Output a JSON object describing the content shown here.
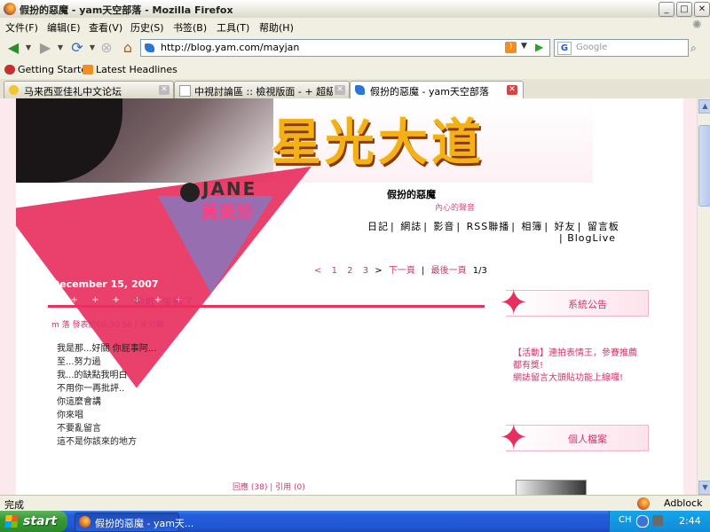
{
  "window": {
    "title": "假扮的惡魔 - yam天空部落 - Mozilla Firefox",
    "controls": {
      "minimize": "_",
      "maximize": "□",
      "close": "✕"
    }
  },
  "menu": [
    "文件(F)",
    "编辑(E)",
    "查看(V)",
    "历史(S)",
    "书签(B)",
    "工具(T)",
    "帮助(H)"
  ],
  "nav": {
    "url": "http://blog.yam.com/mayjan",
    "search_placeholder": "Google"
  },
  "bookmarks": [
    "Getting Started",
    "Latest Headlines"
  ],
  "tabs": [
    {
      "label": "马来西亚佳礼中文论坛",
      "active": false
    },
    {
      "label": "中視討論區 :: 檢視版面 - + 超級星...",
      "active": false
    },
    {
      "label": "假扮的惡魔 - yam天空部落",
      "active": true
    }
  ],
  "banner": {
    "logo": "星光大道",
    "jane": "JANE",
    "jane_cn": "黃美珍"
  },
  "blog": {
    "title": "假扮的惡魔",
    "subtitle": "內心的聲音",
    "nav": [
      "日記",
      "網誌",
      "影音",
      "RSS聯播",
      "相簿",
      "好友",
      "留言板"
    ],
    "nav_row2": "BlogLive",
    "pager": {
      "prev": "<",
      "pages": [
        "1",
        "2",
        "3"
      ],
      "next": ">",
      "next_page": "下一頁",
      "last_page": "最後一頁",
      "position": "1/3"
    }
  },
  "post": {
    "date": "December 15, 2007",
    "title": "抱歉..失態了",
    "meta": "m  落  發表於00:30:58 | 未分類",
    "lines": [
      "我是那...好關 你屁事阿...",
      "至...努力過",
      "我...的缺點我明白",
      "不用你一再批評..",
      "你這麼會講",
      "你來唱",
      "不要亂留言",
      "這不是你該來的地方"
    ],
    "footer": "回應 (38) | 引用 (0)"
  },
  "sidebar": {
    "announce_title": "系統公告",
    "announce_links": [
      "【活動】連拍表情王，參賽推薦",
      "都有獎!",
      "網誌留言大頭貼功能上線囉!"
    ],
    "profile_title": "個人檔案"
  },
  "status": {
    "text": "完成",
    "addon": "Adblock"
  },
  "taskbar": {
    "start": "start",
    "item": "假扮的惡魔 - yam天...",
    "lang": "CH",
    "clock": "2:44"
  },
  "colors": {
    "accent_pink": "#e8305f",
    "link_pink": "#d6336f",
    "logo_gold": "#f4b116",
    "xp_blue": "#245edb"
  }
}
